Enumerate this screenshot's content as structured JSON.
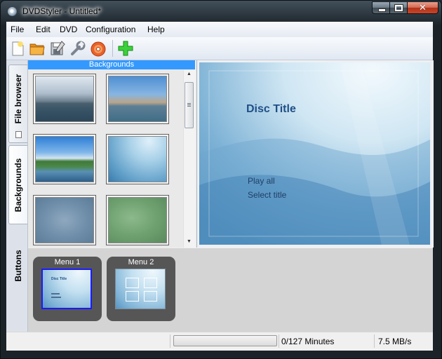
{
  "window": {
    "title": "DVDStyler - Untitled*"
  },
  "menubar": [
    "File",
    "Edit",
    "DVD",
    "Configuration",
    "Help"
  ],
  "toolbar": [
    {
      "name": "new-project-icon"
    },
    {
      "name": "open-folder-icon"
    },
    {
      "name": "save-icon"
    },
    {
      "name": "settings-wrench-icon"
    },
    {
      "name": "burn-dvd-icon"
    },
    {
      "name": "add-green-plus-icon"
    }
  ],
  "side_tabs": {
    "file_browser": "File browser",
    "backgrounds": "Backgrounds",
    "buttons": "Buttons"
  },
  "backgrounds": {
    "header": "Backgrounds"
  },
  "preview": {
    "title": "Disc Title",
    "buttons": [
      "Play all",
      "Select title"
    ]
  },
  "menus": [
    {
      "label": "Menu 1",
      "mini_title": "Disc Title"
    },
    {
      "label": "Menu 2"
    }
  ],
  "status": {
    "minutes": "0/127 Minutes",
    "rate": "7.5 MB/s"
  },
  "colors": {
    "selection": "#3399ff",
    "disc_title": "#1f4f86",
    "thumb_selected": "#1a1aff"
  }
}
